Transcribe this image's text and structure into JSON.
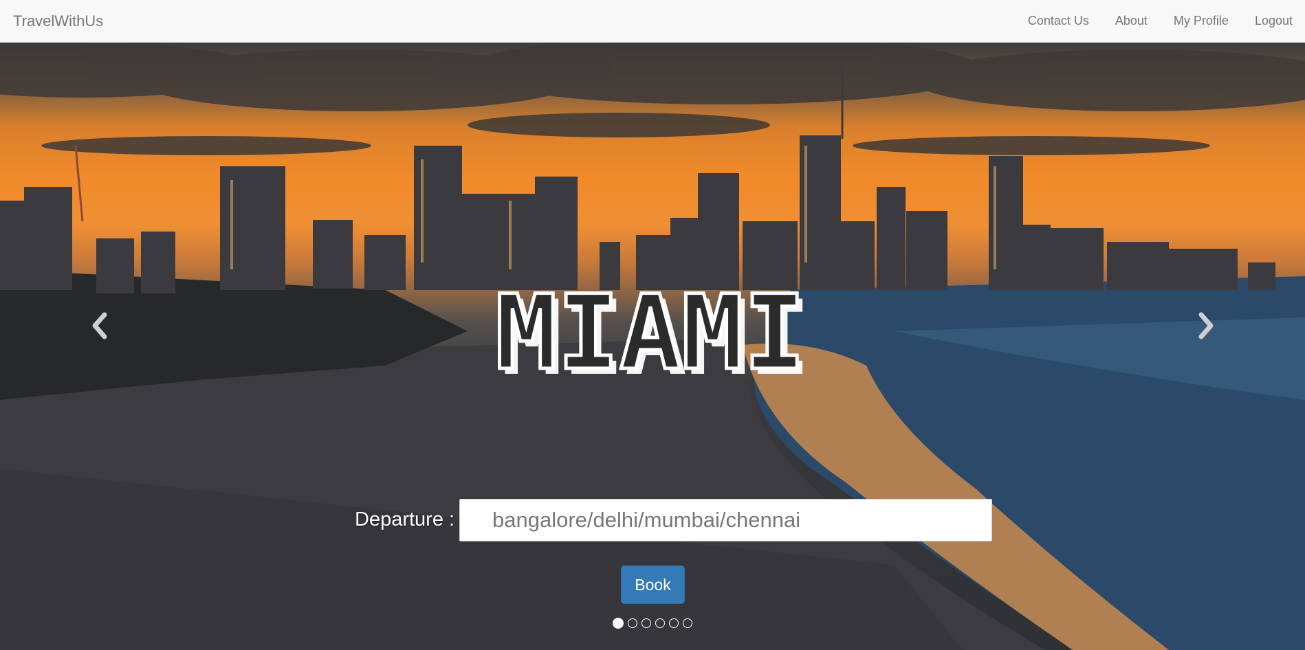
{
  "navbar": {
    "brand": "TravelWithUs",
    "links": [
      {
        "label": "Contact Us"
      },
      {
        "label": "About"
      },
      {
        "label": "My Profile"
      },
      {
        "label": "Logout"
      }
    ]
  },
  "hero": {
    "title": "MIAMI",
    "departure_label": "Departure :",
    "departure_placeholder": "bangalore/delhi/mumbai/chennai",
    "departure_value": "",
    "book_label": "Book",
    "slide_count": 6,
    "active_slide": 0
  },
  "colors": {
    "primary_button": "#337ab7",
    "navbar_bg": "#f8f8f8",
    "navbar_text": "#777777"
  },
  "icons": [
    "chevron-left-icon",
    "chevron-right-icon"
  ]
}
